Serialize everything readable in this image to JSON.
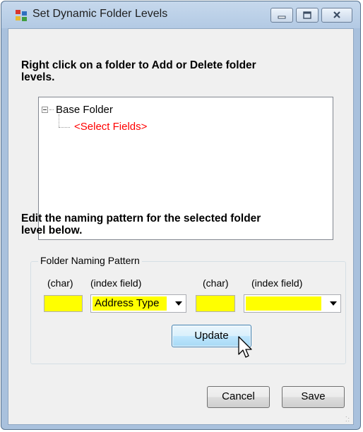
{
  "window": {
    "title": "Set Dynamic Folder Levels"
  },
  "instructions": {
    "line1": "Right click on a folder to Add or Delete folder",
    "line2": "levels.",
    "edit_line1": "Edit the naming pattern for the selected folder",
    "edit_line2": "level below."
  },
  "tree": {
    "root": "Base Folder",
    "child": "<Select Fields>",
    "child_color": "#ff0000"
  },
  "group": {
    "legend": "Folder Naming Pattern",
    "labels": [
      "(char)",
      "(index field)",
      "(char)",
      "(index field)"
    ],
    "char1_value": "",
    "index1_value": "Address Type",
    "char2_value": "",
    "index2_value": "",
    "highlight_color": "#ffff00"
  },
  "buttons": {
    "update": "Update",
    "cancel": "Cancel",
    "save": "Save"
  },
  "icons": {
    "title_icon": "folder-tree-app-icon",
    "minimize": "minimize-icon",
    "maximize": "maximize-icon",
    "close": "close-icon",
    "cursor": "mouse-pointer-icon"
  }
}
